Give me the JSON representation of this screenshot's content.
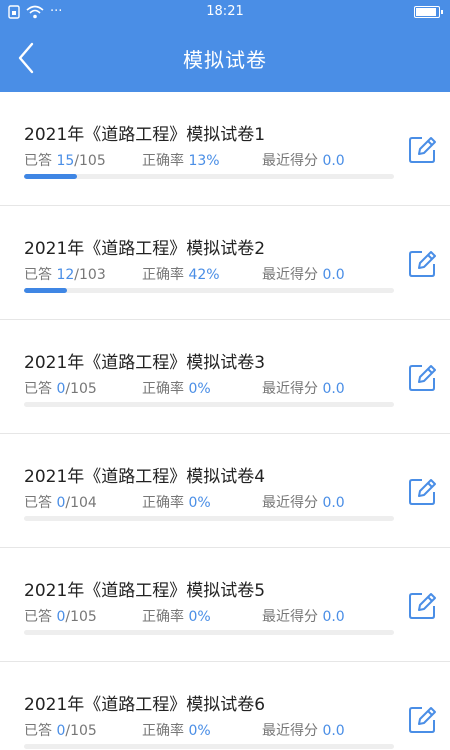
{
  "status": {
    "time": "18:21",
    "dots": "···"
  },
  "header": {
    "title": "模拟试卷"
  },
  "labels": {
    "answered": "已答",
    "sep": "/",
    "accuracy": "正确率",
    "recent": "最近得分"
  },
  "colors": {
    "accent": "#4a8ee6",
    "bar": "#3f86e4"
  },
  "icons": {
    "back": "back-arrow-icon",
    "edit": "edit-icon"
  },
  "papers": [
    {
      "name": "2021年《道路工程》模拟试卷1",
      "done": "15",
      "total": "105",
      "accuracy": "13%",
      "score": "0.0",
      "progress": 0.143
    },
    {
      "name": "2021年《道路工程》模拟试卷2",
      "done": "12",
      "total": "103",
      "accuracy": "42%",
      "score": "0.0",
      "progress": 0.117
    },
    {
      "name": "2021年《道路工程》模拟试卷3",
      "done": "0",
      "total": "105",
      "accuracy": "0%",
      "score": "0.0",
      "progress": 0
    },
    {
      "name": "2021年《道路工程》模拟试卷4",
      "done": "0",
      "total": "104",
      "accuracy": "0%",
      "score": "0.0",
      "progress": 0
    },
    {
      "name": "2021年《道路工程》模拟试卷5",
      "done": "0",
      "total": "105",
      "accuracy": "0%",
      "score": "0.0",
      "progress": 0
    },
    {
      "name": "2021年《道路工程》模拟试卷6",
      "done": "0",
      "total": "105",
      "accuracy": "0%",
      "score": "0.0",
      "progress": 0
    }
  ]
}
